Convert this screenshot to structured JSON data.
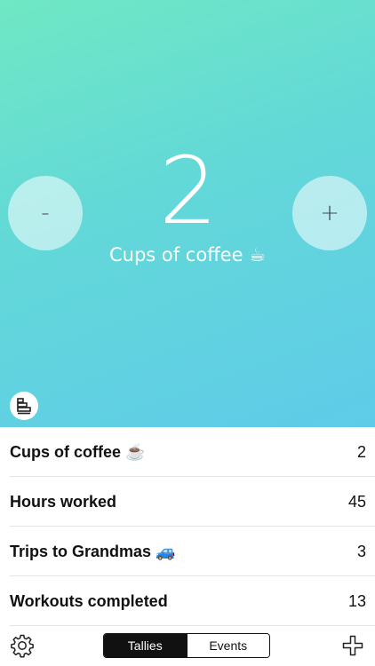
{
  "current": {
    "count": "2",
    "title": "Cups of coffee ☕"
  },
  "controls": {
    "decrement_label": "-",
    "increment_label": "+"
  },
  "icons": {
    "stats": "stats-icon",
    "settings": "gear-icon",
    "add": "plus-icon"
  },
  "tallies": [
    {
      "label": "Cups of coffee ☕",
      "value": "2"
    },
    {
      "label": "Hours worked",
      "value": "45"
    },
    {
      "label": "Trips to Grandmas 🚙",
      "value": "3"
    },
    {
      "label": "Workouts completed",
      "value": "13"
    }
  ],
  "toolbar": {
    "tabs": [
      {
        "label": "Tallies",
        "active": true
      },
      {
        "label": "Events",
        "active": false
      }
    ]
  },
  "colors": {
    "gradient_start": "#6fe8c4",
    "gradient_end": "#5fcbe9",
    "segment_active": "#111111"
  }
}
